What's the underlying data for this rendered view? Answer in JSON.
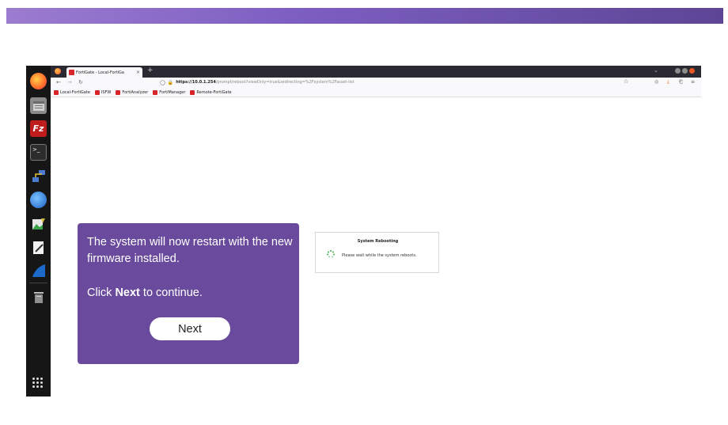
{
  "browser": {
    "tab_title": "FortiGate - Local-FortiGa",
    "tab_close": "×",
    "new_tab": "+",
    "url_host": "https://10.0.1.254",
    "url_path": "/prompt/reboot?viewOnly=true&redirecting=%2Fsystem%2Fasset-list",
    "bookmarks": [
      {
        "label": "Local-FortiGate"
      },
      {
        "label": "ISFW"
      },
      {
        "label": "FortiAnalyzer"
      },
      {
        "label": "FortiManager"
      },
      {
        "label": "Remote-FortiGate"
      }
    ]
  },
  "reboot_dialog": {
    "title": "System Rebooting",
    "message": "Please wait while the system reboots."
  },
  "callout": {
    "line1": "The system will now restart with the new firmware installed.",
    "line2_prefix": "Click ",
    "line2_bold": "Next",
    "line2_suffix": " to continue.",
    "next_label": "Next"
  },
  "colors": {
    "banner": "#7d5fc2",
    "callout_bg": "#6a4a9d",
    "fortinet_red": "#d8262d"
  },
  "icons": {
    "dock": [
      "firefox-icon",
      "files-icon",
      "filezilla-icon",
      "terminal-icon",
      "network-icon",
      "thunderbird-icon",
      "image-viewer-icon",
      "text-editor-icon",
      "wireshark-icon",
      "trash-icon",
      "app-grid-icon"
    ]
  }
}
